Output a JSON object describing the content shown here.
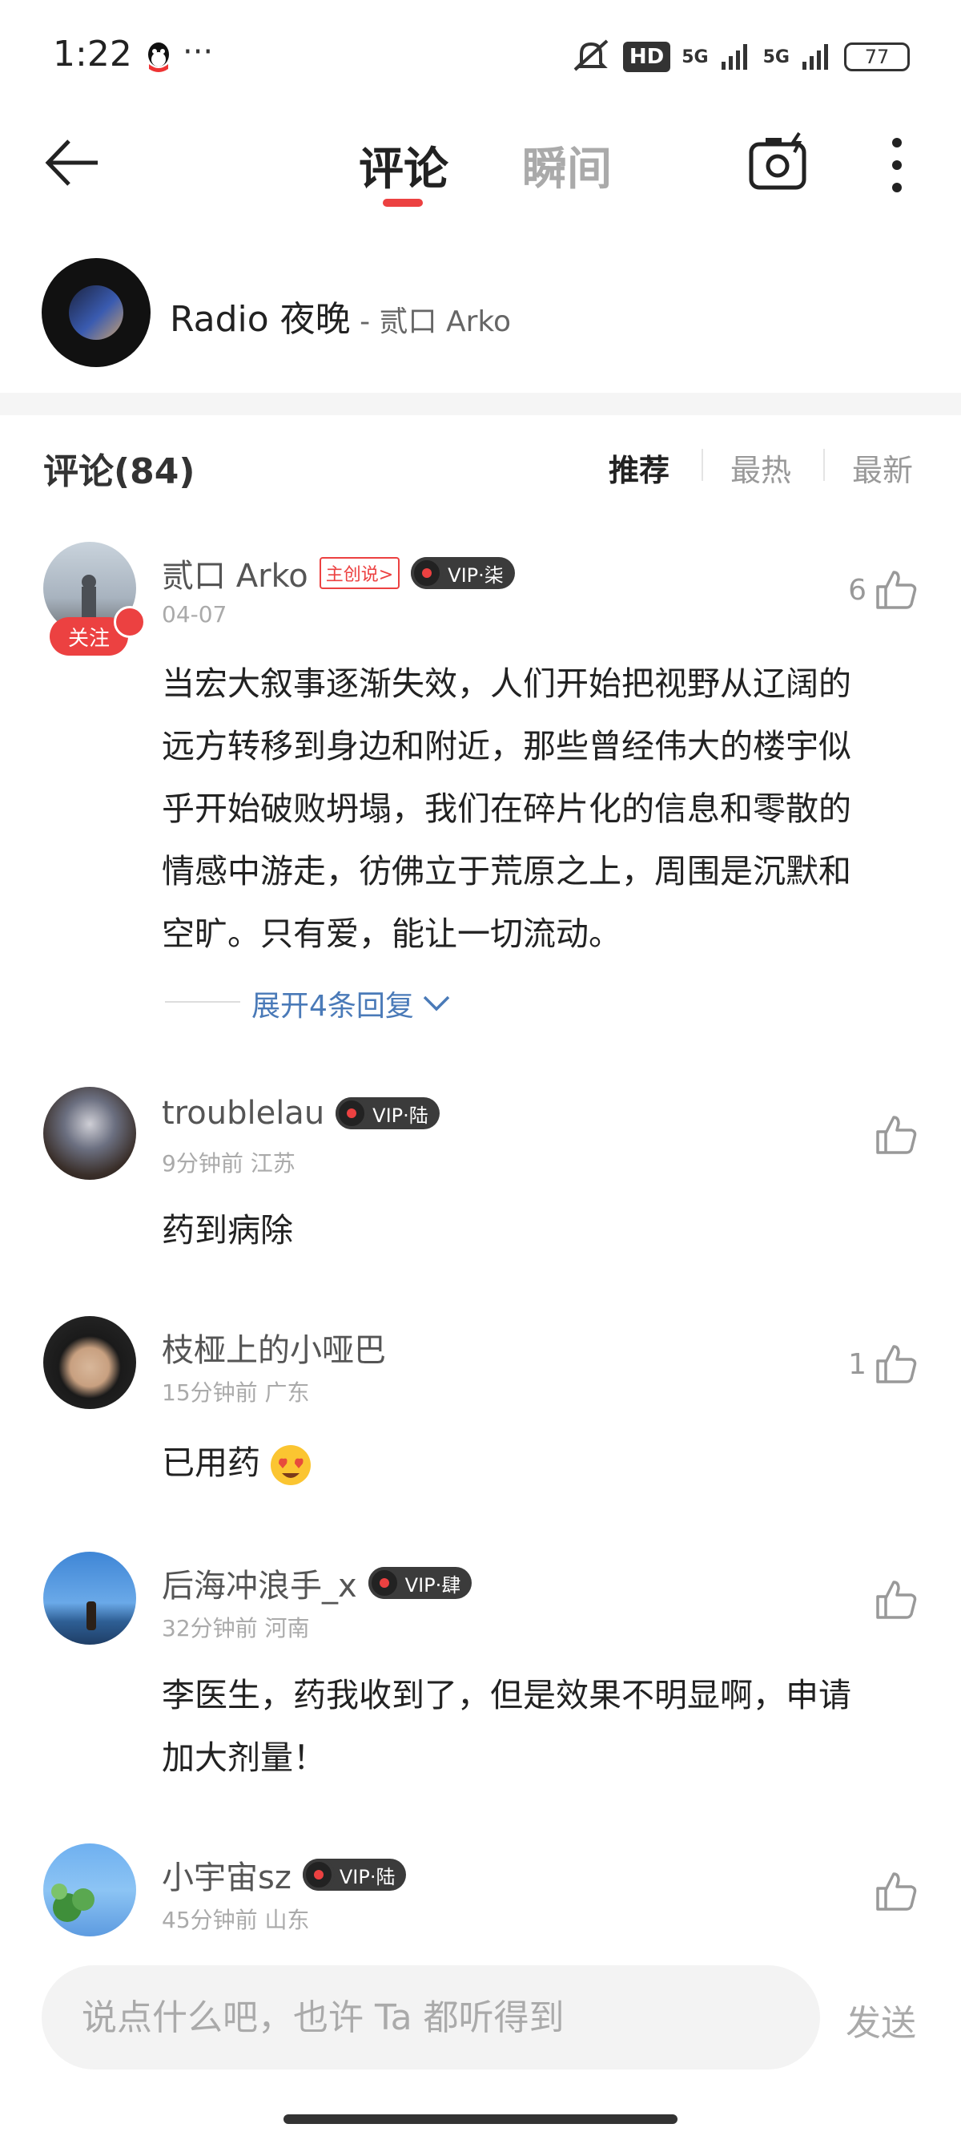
{
  "status_bar": {
    "time": "1:22",
    "dots": "···",
    "hd": "HD",
    "net1": "5G",
    "net2": "5G",
    "battery": "77"
  },
  "header": {
    "tab_comments": "评论",
    "tab_moments": "瞬间"
  },
  "song": {
    "title": "Radio 夜晚",
    "artist": " - 贰口 Arko"
  },
  "comments_header": {
    "count_label": "评论(84)",
    "sort_recommend": "推荐",
    "sort_hot": "最热",
    "sort_new": "最新"
  },
  "comments": [
    {
      "username": "贰口 Arko",
      "creator_tag": "主创说>",
      "vip": "VIP·柒",
      "meta": "04-07",
      "likes": "6",
      "follow_label": "关注",
      "lines": [
        "当宏大叙事逐渐失效，人们开始把视野从辽阔的",
        "远方转移到身边和附近，那些曾经伟大的楼宇似",
        "乎开始破败坍塌，我们在碎片化的信息和零散的",
        "情感中游走，彷佛立于荒原之上，周围是沉默和",
        "空旷。只有爱，能让一切流动。"
      ],
      "expand_label": "展开4条回复"
    },
    {
      "username": "troublelau",
      "vip": "VIP·陆",
      "meta": "9分钟前 江苏",
      "likes": "",
      "text": "药到病除"
    },
    {
      "username": "枝桠上的小哑巴",
      "meta": "15分钟前 广东",
      "likes": "1",
      "text": "已用药"
    },
    {
      "username": "后海冲浪手_x",
      "vip": "VIP·肆",
      "meta": "32分钟前 河南",
      "likes": "",
      "lines": [
        "李医生，药我收到了，但是效果不明显啊，申请",
        "加大剂量！"
      ]
    },
    {
      "username": "小宇宙sz",
      "vip": "VIP·陆",
      "meta": "45分钟前 山东",
      "likes": ""
    }
  ],
  "input": {
    "placeholder": "说点什么吧，也许 Ta 都听得到",
    "send_label": "发送"
  }
}
